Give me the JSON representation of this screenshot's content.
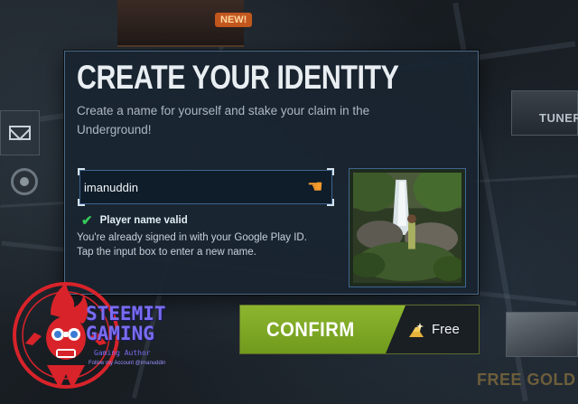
{
  "dialog": {
    "title": "CREATE YOUR IDENTITY",
    "subtitle": "Create a name for yourself and stake your claim in the Underground!",
    "name_input_value": "imanuddin",
    "valid_message": "Player name valid",
    "info_line1": "You're already signed in with your Google Play ID.",
    "info_line2": "Tap the input box to enter a new name."
  },
  "confirm": {
    "label": "CONFIRM",
    "cost_label": "Free",
    "cost_icon": "gold-bars-icon"
  },
  "background": {
    "new_badge": "NEW!",
    "tuner_label": "TUNER",
    "free_gold_label": "FREE GOLD"
  },
  "watermark": {
    "line1": "STEEMIT",
    "line2": "GAMING",
    "line3": "Gaming Author",
    "line4": "Follow my Account @imanuddin"
  },
  "colors": {
    "dialog_bg": "#192430",
    "dialog_border": "#4d6a86",
    "confirm_green": "#7ea928",
    "valid_check": "#35c759",
    "tap_icon": "#f39a2a",
    "logo_red": "#d8232a",
    "logo_purple": "#7a6cf0"
  }
}
